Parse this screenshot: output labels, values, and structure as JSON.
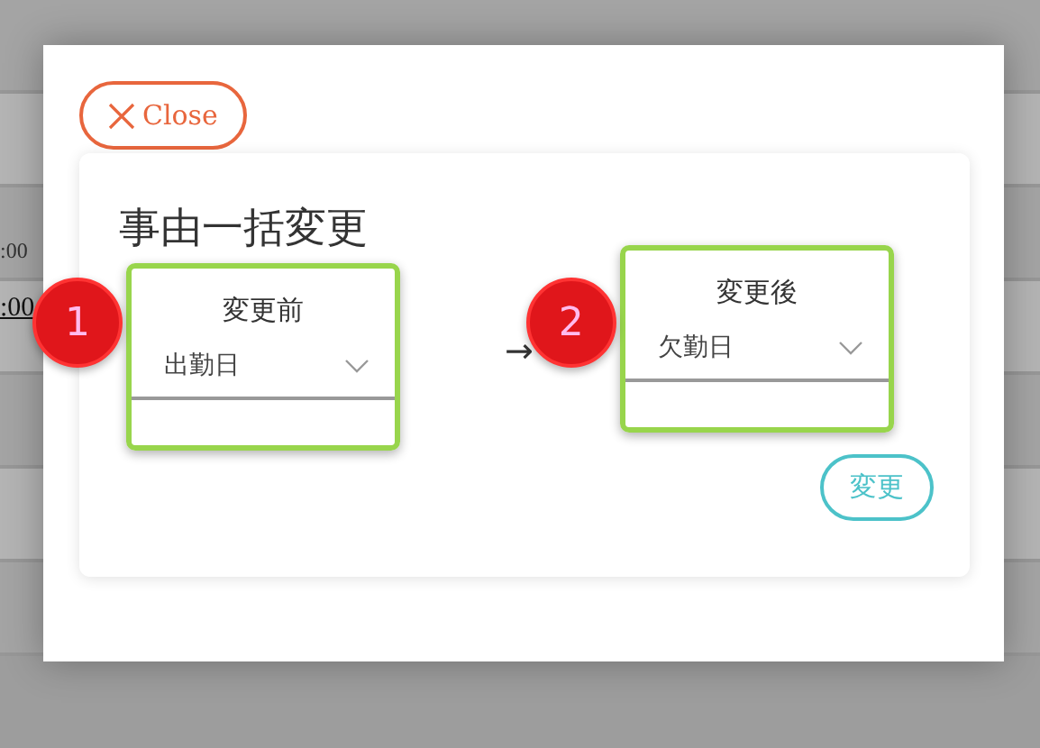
{
  "background": {
    "texts": [
      {
        "text": ":00",
        "underlined": false
      },
      {
        "text": ":00",
        "underlined": true
      }
    ]
  },
  "dialog": {
    "close_button": {
      "label": "Close"
    },
    "title": "事由一括変更",
    "fields": [
      {
        "badge": "1",
        "label": "変更前",
        "value": "出勤日"
      },
      {
        "badge": "2",
        "label": "変更後",
        "value": "欠勤日"
      }
    ],
    "arrow": "→",
    "submit_button": "変更"
  }
}
